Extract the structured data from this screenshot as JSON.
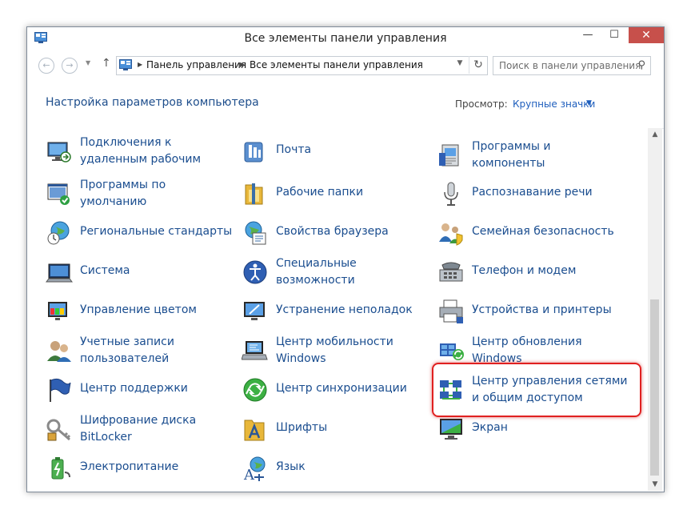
{
  "window": {
    "title": "Все элементы панели управления",
    "close_symbol": "✕",
    "min_symbol": "—",
    "max_symbol": "☐"
  },
  "nav": {
    "back_symbol": "←",
    "forward_symbol": "→",
    "up_symbol": "↑",
    "recent_symbol": "▼",
    "breadcrumbs": [
      "Панель управления",
      "Все элементы панели управления"
    ],
    "search_placeholder": "Поиск в панели управления",
    "refresh_symbol": "↻"
  },
  "header": {
    "title": "Настройка параметров компьютера",
    "view_label": "Просмотр:",
    "view_value": "Крупные значки"
  },
  "items": [
    {
      "label": "Подключения к\nудаленным рабочим",
      "icon": "remote-desktop-icon"
    },
    {
      "label": "Почта",
      "icon": "mail-icon"
    },
    {
      "label": "Программы и\nкомпоненты",
      "icon": "programs-icon"
    },
    {
      "label": "Программы по\nумолчанию",
      "icon": "default-programs-icon"
    },
    {
      "label": "Рабочие папки",
      "icon": "work-folders-icon"
    },
    {
      "label": "Распознавание речи",
      "icon": "microphone-icon"
    },
    {
      "label": "Региональные стандарты",
      "icon": "region-clock-icon"
    },
    {
      "label": "Свойства браузера",
      "icon": "internet-options-icon"
    },
    {
      "label": "Семейная безопасность",
      "icon": "family-safety-icon"
    },
    {
      "label": "Система",
      "icon": "system-icon"
    },
    {
      "label": "Специальные\nвозможности",
      "icon": "ease-of-access-icon"
    },
    {
      "label": "Телефон и модем",
      "icon": "phone-modem-icon"
    },
    {
      "label": "Управление цветом",
      "icon": "color-management-icon"
    },
    {
      "label": "Устранение неполадок",
      "icon": "troubleshooting-icon"
    },
    {
      "label": "Устройства и принтеры",
      "icon": "printer-icon"
    },
    {
      "label": "Учетные записи\nпользователей",
      "icon": "user-accounts-icon"
    },
    {
      "label": "Центр мобильности\nWindows",
      "icon": "mobility-center-icon"
    },
    {
      "label": "Центр обновления\nWindows",
      "icon": "windows-update-icon"
    },
    {
      "label": "Центр поддержки",
      "icon": "action-center-flag-icon"
    },
    {
      "label": "Центр синхронизации",
      "icon": "sync-center-icon"
    },
    {
      "label": "Центр управления сетями\nи общим доступом",
      "icon": "network-center-icon"
    },
    {
      "label": "Шифрование диска\nBitLocker",
      "icon": "bitlocker-key-icon"
    },
    {
      "label": "Шрифты",
      "icon": "fonts-icon"
    },
    {
      "label": "Экран",
      "icon": "display-icon"
    },
    {
      "label": "Электропитание",
      "icon": "power-options-icon"
    },
    {
      "label": "Язык",
      "icon": "language-icon"
    }
  ],
  "scrollbar": {
    "up_symbol": "▲",
    "down_symbol": "▼"
  }
}
